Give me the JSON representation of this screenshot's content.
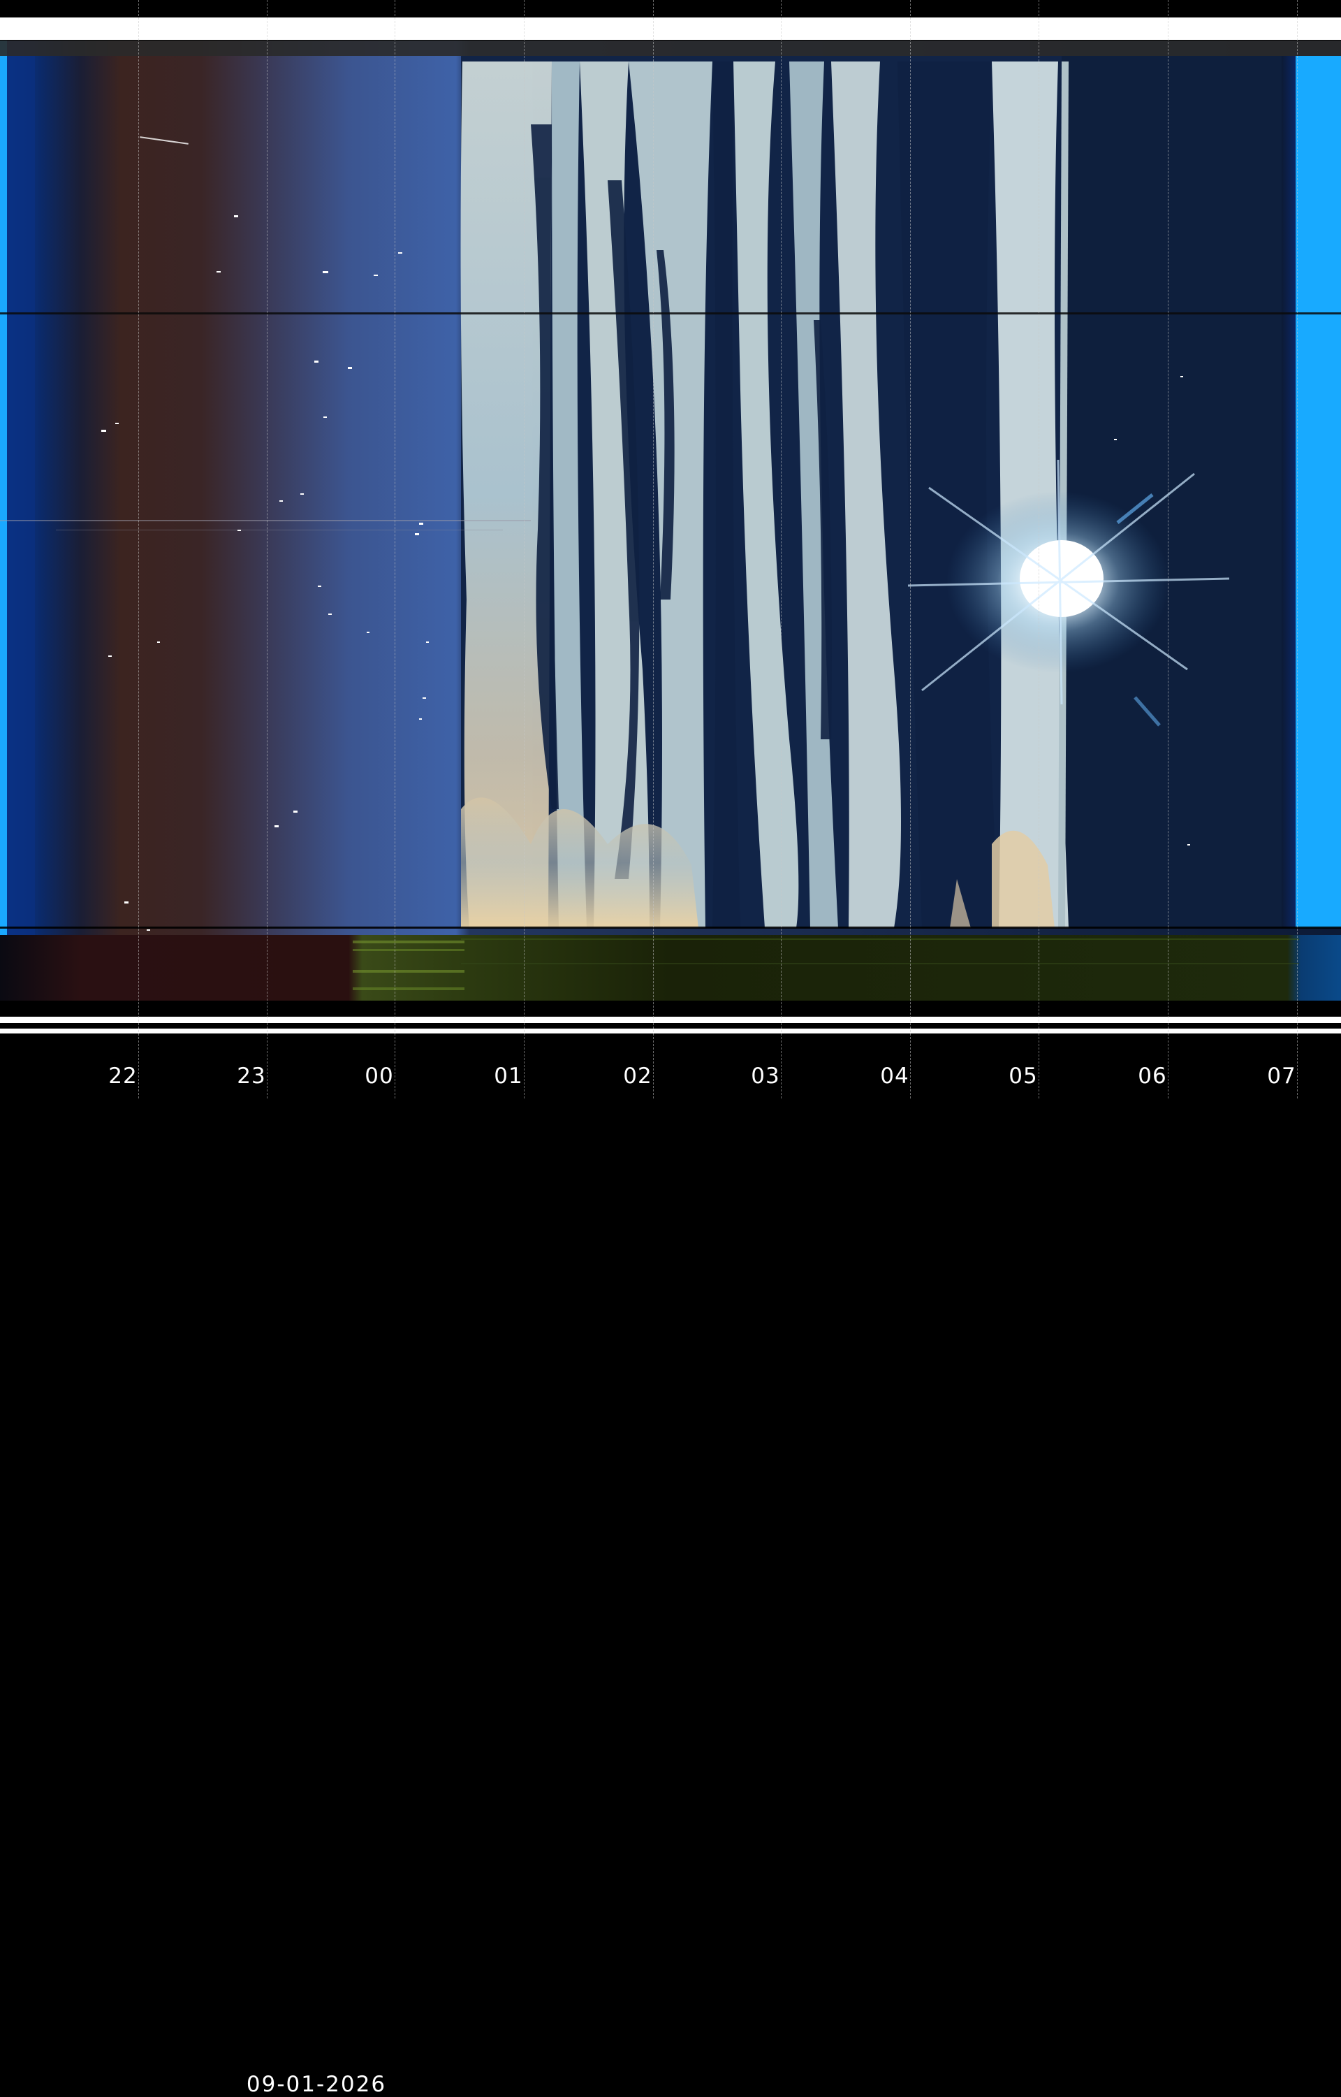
{
  "image": {
    "kind": "all-sky keogram",
    "date": "09-01-2026",
    "time_axis_labels": [
      "22",
      "23",
      "00",
      "01",
      "02",
      "03",
      "04",
      "05",
      "06",
      "07"
    ]
  },
  "colors": {
    "night_sky": "#3a5da0",
    "twilight_left": "#3b2a2a",
    "cloud": "#b9cfd6",
    "cloud_warm": "#d8c3a4",
    "dark_sky": "#0d1e3c",
    "edge_blue": "#1a9fff",
    "ground_green": "#2d3d12",
    "ground_brown": "#2a1010"
  }
}
